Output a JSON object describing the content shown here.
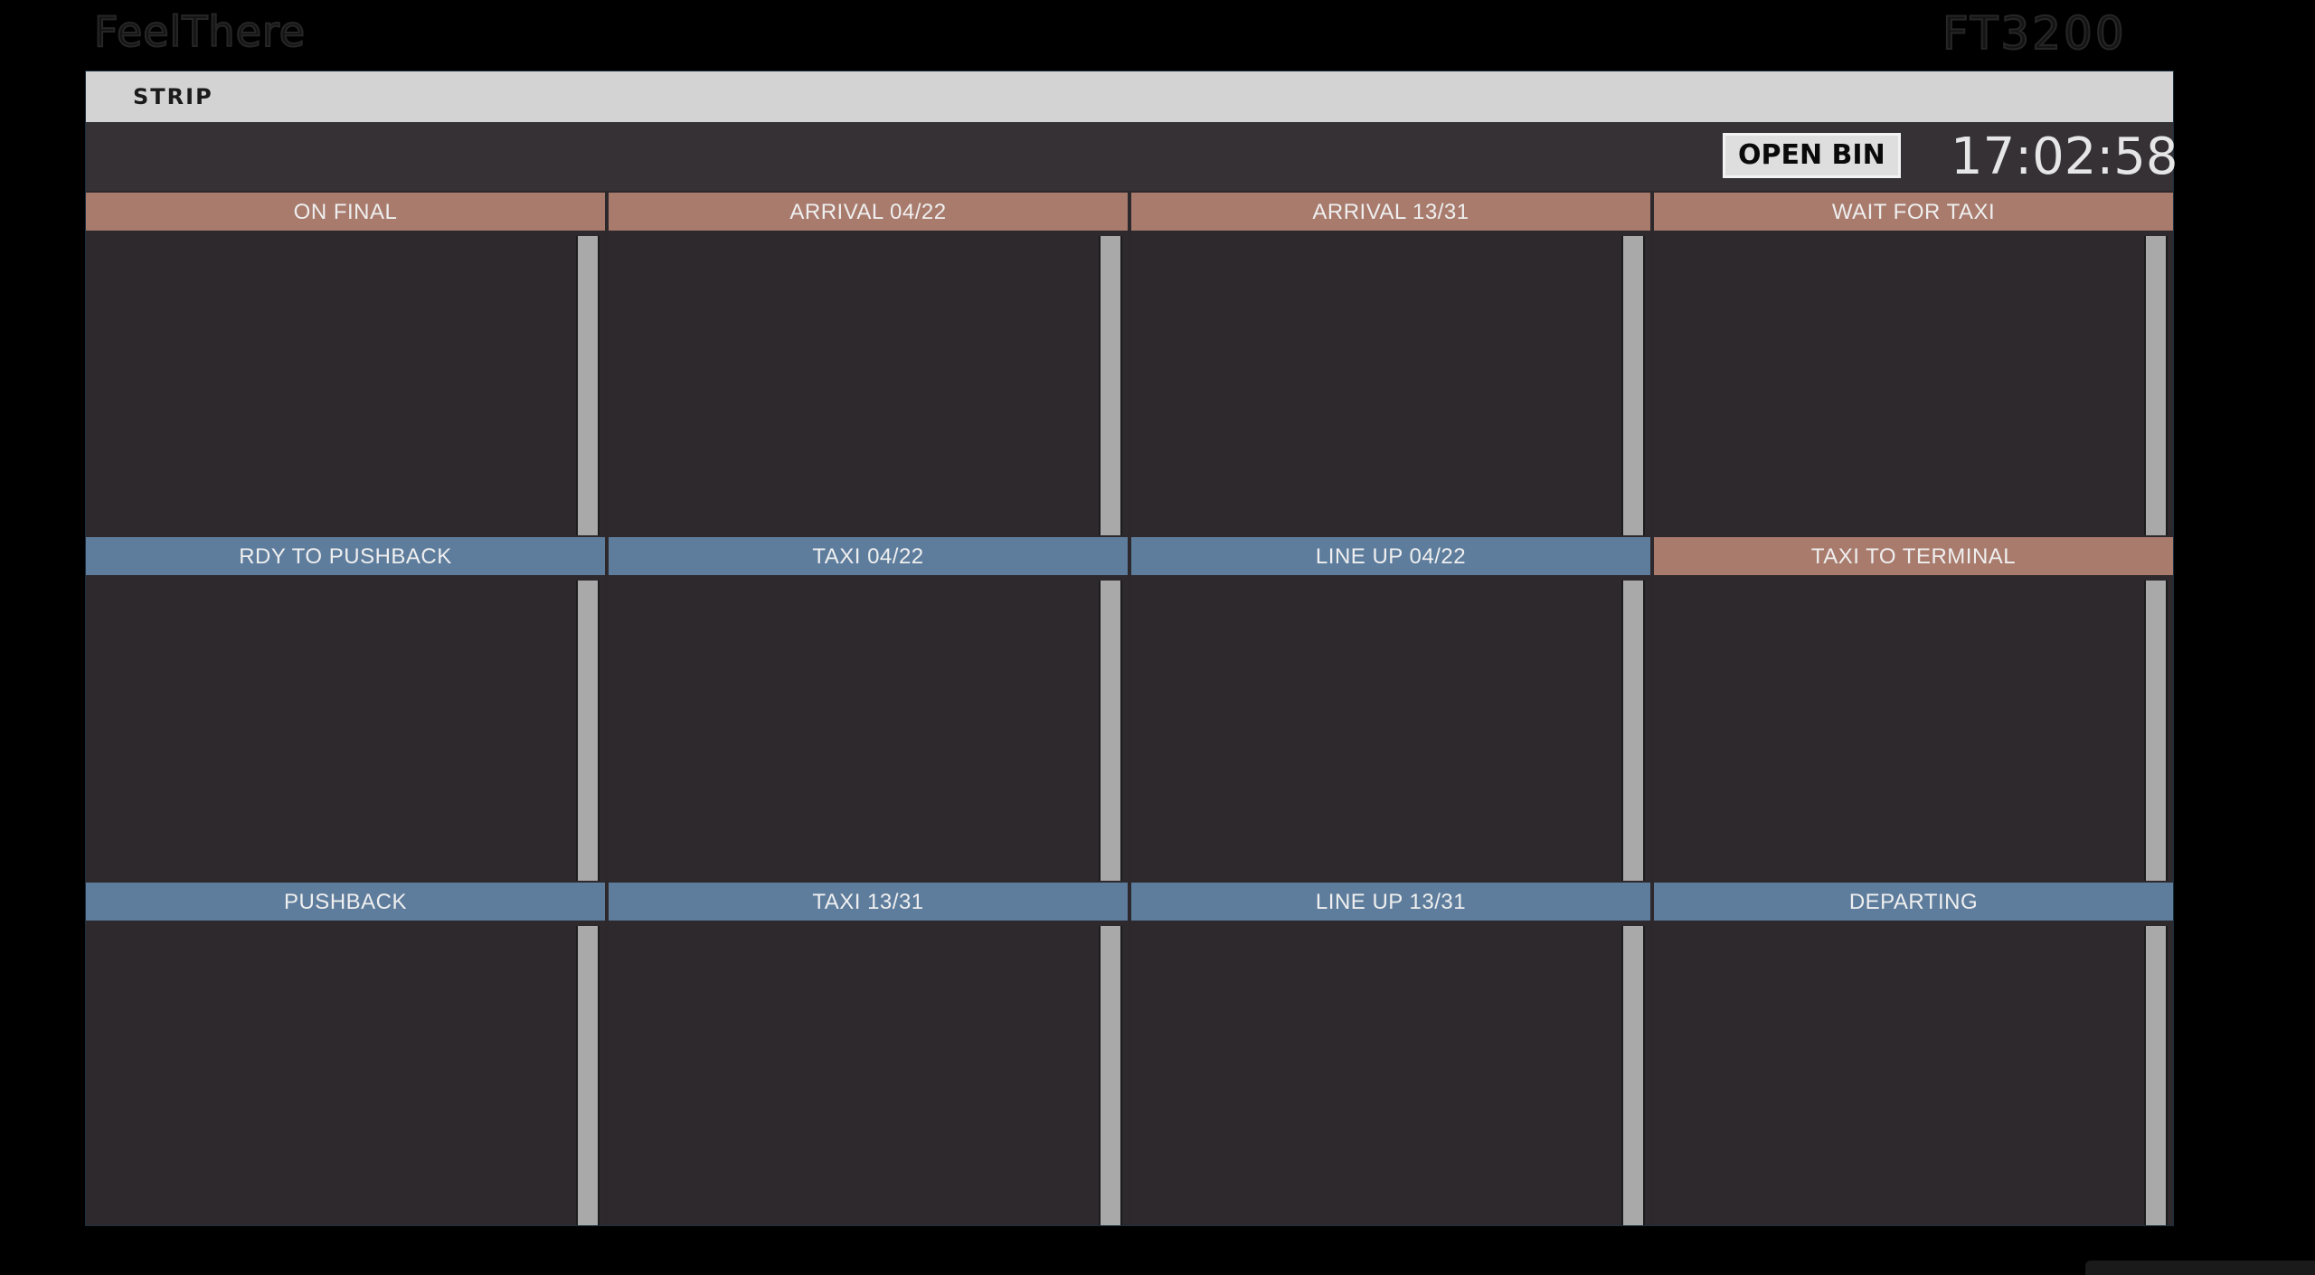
{
  "brand": {
    "left": "FeelThere",
    "right": "FT3200"
  },
  "window": {
    "title": "STRIP"
  },
  "topbar": {
    "open_bin_label": "OPEN BIN",
    "clock": "17:02:58"
  },
  "bays": [
    {
      "label": "ON FINAL",
      "kind": "arrival"
    },
    {
      "label": "ARRIVAL 04/22",
      "kind": "arrival"
    },
    {
      "label": "ARRIVAL 13/31",
      "kind": "arrival"
    },
    {
      "label": "WAIT FOR TAXI",
      "kind": "arrival"
    },
    {
      "label": "RDY TO PUSHBACK",
      "kind": "departure"
    },
    {
      "label": "TAXI 04/22",
      "kind": "departure"
    },
    {
      "label": "LINE UP 04/22",
      "kind": "departure"
    },
    {
      "label": "TAXI TO TERMINAL",
      "kind": "arrival"
    },
    {
      "label": "PUSHBACK",
      "kind": "departure"
    },
    {
      "label": "TAXI 13/31",
      "kind": "departure"
    },
    {
      "label": "LINE UP 13/31",
      "kind": "departure"
    },
    {
      "label": "DEPARTING",
      "kind": "departure"
    }
  ],
  "colors": {
    "arrival_header": "#a87b6d",
    "departure_header": "#5e7d9d",
    "panel_background": "#2c282c",
    "titlebar": "#d3d3d3"
  }
}
